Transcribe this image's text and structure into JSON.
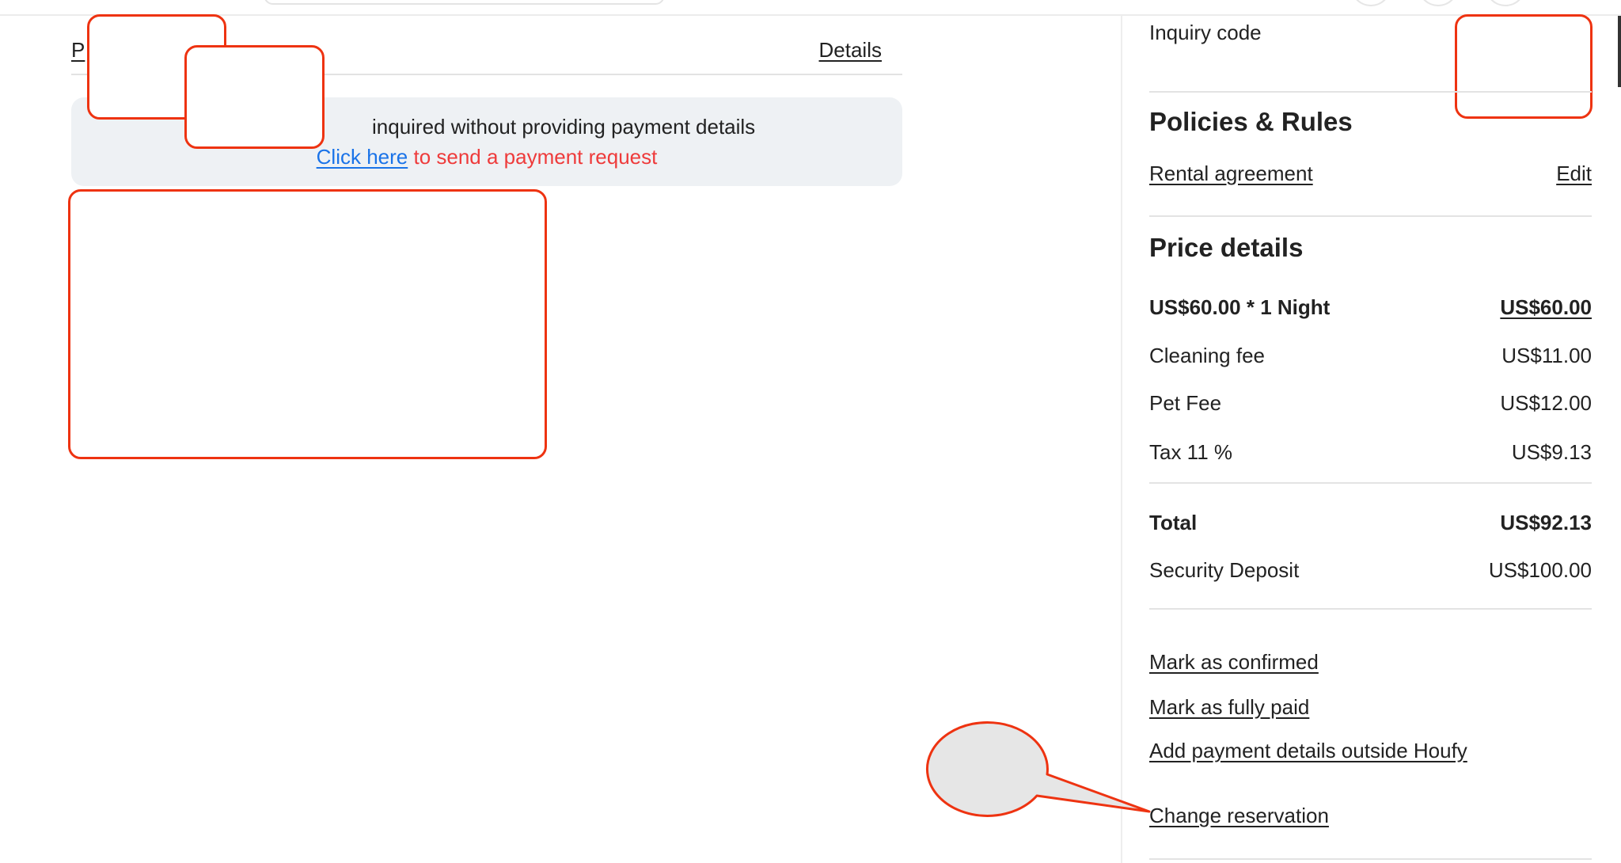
{
  "main": {
    "tab_partial_label": "P",
    "details_link": "Details",
    "notice": {
      "message": "inquired without providing payment details",
      "link_label": "Click here",
      "link_suffix": " to send a payment request"
    }
  },
  "sidebar": {
    "inquiry_code_label": "Inquiry code",
    "policies_heading": "Policies & Rules",
    "rental_agreement_link": "Rental agreement",
    "edit_link": "Edit",
    "price_heading": "Price details",
    "price_rows": [
      {
        "label": "US$60.00 * 1 Night",
        "value": "US$60.00"
      },
      {
        "label": "Cleaning fee",
        "value": "US$11.00"
      },
      {
        "label": "Pet Fee",
        "value": "US$12.00"
      },
      {
        "label": "Tax 11 %",
        "value": "US$9.13"
      }
    ],
    "total": {
      "label": "Total",
      "value": "US$92.13"
    },
    "security_deposit": {
      "label": "Security Deposit",
      "value": "US$100.00"
    },
    "actions": [
      "Mark as confirmed",
      "Mark as fully paid",
      "Add payment details outside Houfy",
      "Change reservation"
    ]
  },
  "colors": {
    "link_blue": "#1a73e8",
    "notice_red": "#ee3b3b",
    "notice_bg": "#eef1f4",
    "annotation_red": "#ee3311",
    "callout_fill": "#e6e6e6"
  }
}
